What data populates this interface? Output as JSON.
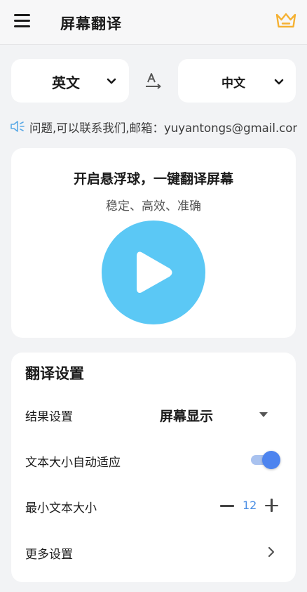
{
  "header": {
    "title": "屏幕翻译",
    "menu_icon": "menu-icon",
    "vip_icon": "crown-icon"
  },
  "language": {
    "source": "英文",
    "target": "中文",
    "swap_icon": "translate-swap-icon"
  },
  "notice": {
    "text": "问题,可以联系我们,邮箱：yuyantongs@gmail.com",
    "icon": "speaker-icon"
  },
  "float_card": {
    "title": "开启悬浮球，一键翻译屏幕",
    "subtitle": "稳定、高效、准确",
    "play_icon": "play-icon"
  },
  "settings": {
    "title": "翻译设置",
    "result_label": "结果设置",
    "result_value": "屏幕显示",
    "autosize_label": "文本大小自动适应",
    "autosize_enabled": true,
    "minsize_label": "最小文本大小",
    "minsize_value": "12",
    "more_label": "更多设置"
  },
  "colors": {
    "accent_blue": "#4d84ef",
    "play_blue": "#5bc8f5",
    "crown_gold": "#f5b133",
    "stepper_value": "#4a8ee4",
    "speaker_blue": "#5aa9e6"
  }
}
